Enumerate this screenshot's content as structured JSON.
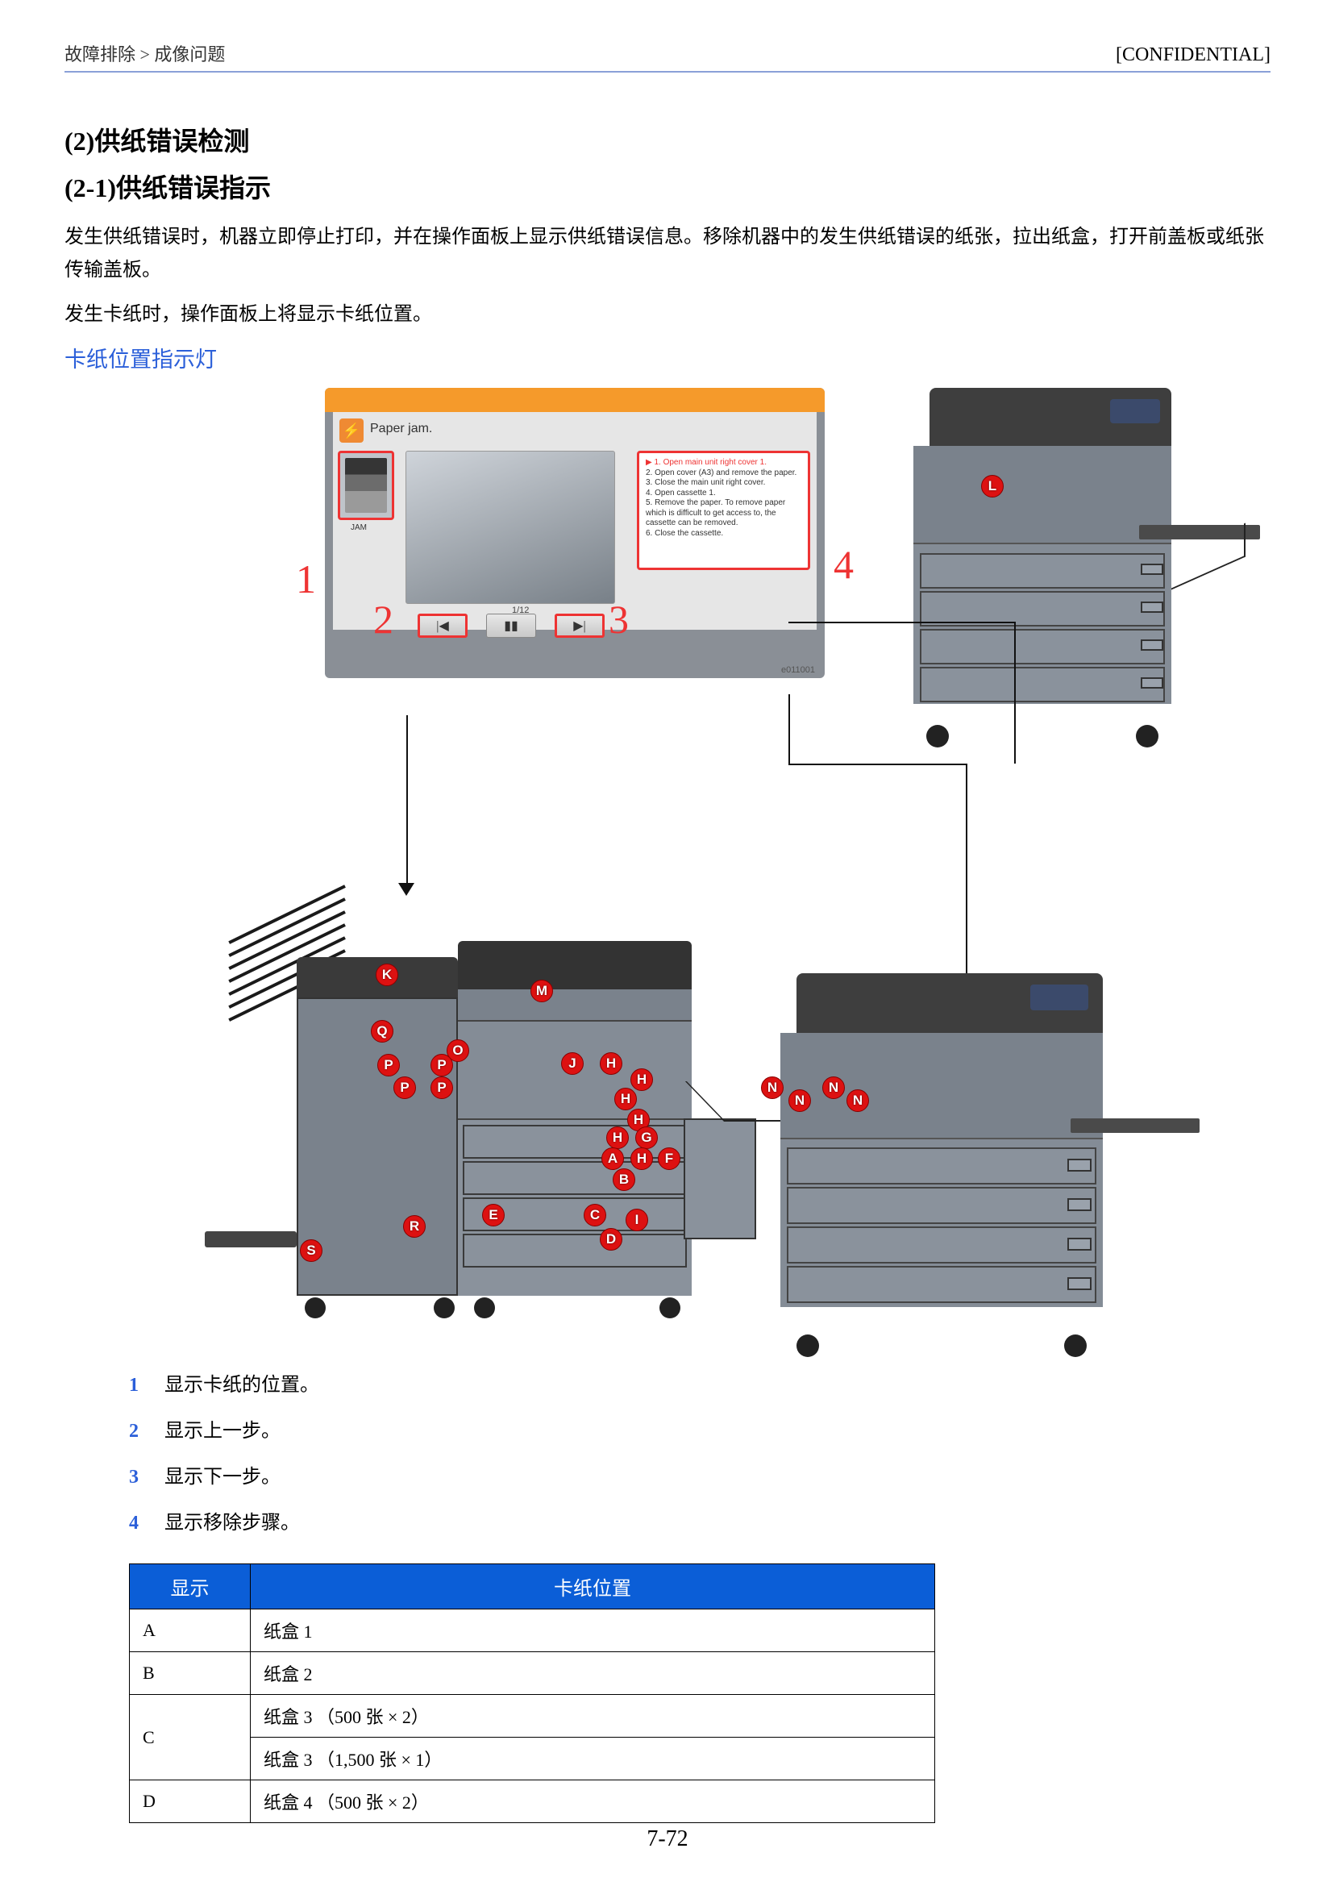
{
  "header": {
    "breadcrumb": "故障排除 > 成像问题",
    "confidential": "[CONFIDENTIAL]"
  },
  "section": {
    "h2": "(2)供纸错误检测",
    "h3": "(2-1)供纸错误指示",
    "p1": "发生供纸错误时，机器立即停止打印，并在操作面板上显示供纸错误信息。移除机器中的发生供纸错误的纸张，拉出纸盒，打开前盖板或纸张传输盖板。",
    "p2": "发生卡纸时，操作面板上将显示卡纸位置。",
    "sub": "卡纸位置指示灯"
  },
  "panel": {
    "jam_title": "Paper jam.",
    "jam_label": "JAM",
    "instr1": "1. Open main unit right cover 1.",
    "instr2": "2. Open cover (A3) and remove the paper.",
    "instr3": "3. Close the main unit right cover.",
    "instr4": "4. Open cassette 1.",
    "instr5": "5. Remove the paper. To remove paper which is difficult to get access to, the cassette can be removed.",
    "instr6": "6. Close the cassette.",
    "counter": "1/12",
    "prev": "|◀",
    "pause": "▮▮",
    "next": "▶|",
    "code": "e011001"
  },
  "callouts": {
    "n1": "1",
    "n2": "2",
    "n3": "3",
    "n4": "4"
  },
  "badges": {
    "L": "L",
    "K": "K",
    "M": "M",
    "Q": "Q",
    "O": "O",
    "J": "J",
    "H": "H",
    "G": "G",
    "A": "A",
    "B": "B",
    "F": "F",
    "E": "E",
    "C": "C",
    "I": "I",
    "D": "D",
    "R": "R",
    "S": "S",
    "P": "P",
    "N": "N"
  },
  "legend": {
    "i1": {
      "n": "1",
      "t": "显示卡纸的位置。"
    },
    "i2": {
      "n": "2",
      "t": "显示上一步。"
    },
    "i3": {
      "n": "3",
      "t": "显示下一步。"
    },
    "i4": {
      "n": "4",
      "t": "显示移除步骤。"
    }
  },
  "table": {
    "h_display": "显示",
    "h_location": "卡纸位置",
    "rows": {
      "A": {
        "l": "A",
        "v": "纸盒 1"
      },
      "B": {
        "l": "B",
        "v": "纸盒 2"
      },
      "C1": {
        "l": "C",
        "v": "纸盒 3 （500 张 × 2）"
      },
      "C2": {
        "v": "纸盒 3 （1,500 张 × 1）"
      },
      "D": {
        "l": "D",
        "v": "纸盒 4 （500 张 × 2）"
      }
    }
  },
  "page_num": "7-72"
}
